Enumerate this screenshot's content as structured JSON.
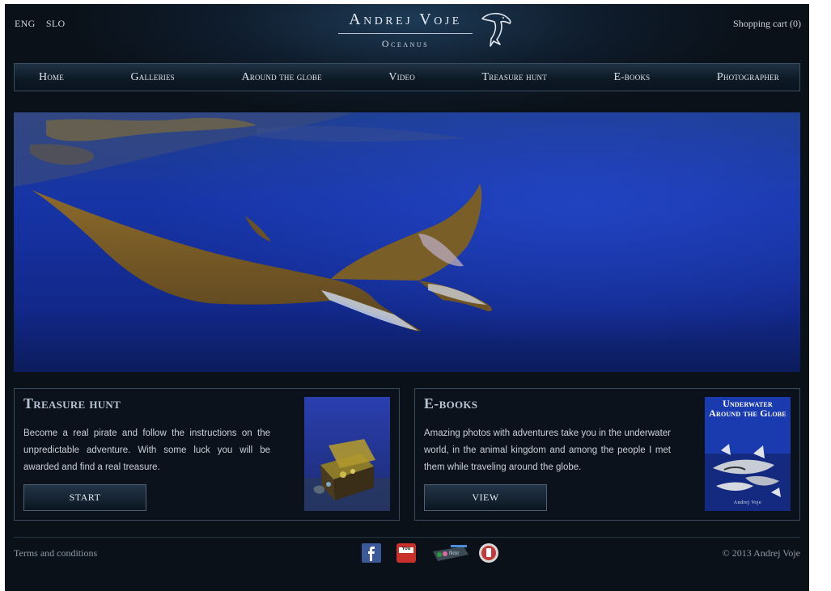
{
  "header": {
    "languages": [
      "ENG",
      "SLO"
    ],
    "logo_title": "Andrej Voje",
    "logo_subtitle": "Oceanus",
    "cart_label": "Shopping cart (0)"
  },
  "nav": {
    "items": [
      "Home",
      "Galleries",
      "Around the globe",
      "Video",
      "Treasure hunt",
      "E-books",
      "Photographer"
    ]
  },
  "boxes": {
    "treasure": {
      "title": "Treasure hunt",
      "text": "Become a real pirate and follow the instructions on the unpredictable adventure. With some luck you will be awarded and find a real treasure.",
      "button": "START"
    },
    "ebooks": {
      "title": "E-books",
      "text": "Amazing photos with adventures take you in the underwater world, in the animal kingdom and among the people I met them while traveling around the globe.",
      "button": "VIEW",
      "cover_title": "Underwater Around the Globe",
      "cover_author": "Andrej Voje"
    }
  },
  "footer": {
    "terms": "Terms and conditions",
    "copyright": "© 2013 Andrej Voje",
    "social_icons": [
      "facebook-icon",
      "youtube-icon",
      "flickr-icon",
      "mobile-app-icon"
    ],
    "youtube_text": "You",
    "flickr_text": "flickr"
  },
  "colors": {
    "background": "#0a1119",
    "nav_border": "#3b4e60",
    "accent_title": "#b7c4d3",
    "ocean_blue": "#1a3aa0"
  }
}
